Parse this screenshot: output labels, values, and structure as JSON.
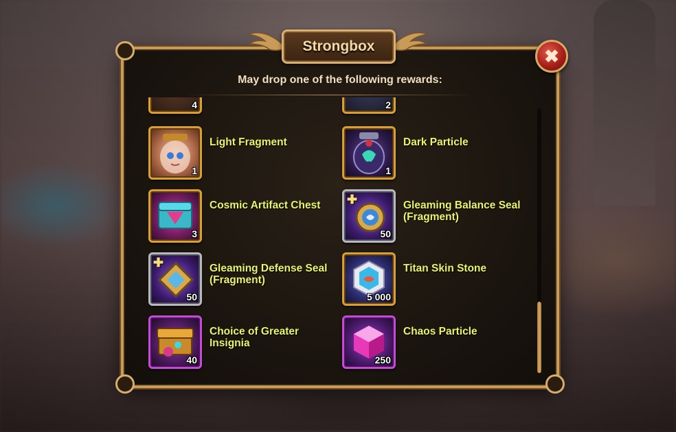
{
  "dialog": {
    "title": "Strongbox",
    "subtitle": "May drop one of the following rewards:",
    "close_glyph": "✖"
  },
  "partial_items": [
    {
      "count": "4"
    },
    {
      "count": "2"
    }
  ],
  "items": [
    {
      "name": "Light Fragment",
      "count": "1",
      "icon": "light-fragment-jar-icon"
    },
    {
      "name": "Dark Particle",
      "count": "1",
      "icon": "dark-particle-jar-icon"
    },
    {
      "name": "Cosmic Artifact Chest",
      "count": "3",
      "icon": "cosmic-artifact-chest-icon"
    },
    {
      "name": "Gleaming Balance Seal (Fragment)",
      "count": "50",
      "icon": "balance-seal-icon"
    },
    {
      "name": "Gleaming Defense Seal (Fragment)",
      "count": "50",
      "icon": "defense-seal-icon"
    },
    {
      "name": "Titan Skin Stone",
      "count": "5 000",
      "icon": "titan-skin-stone-icon"
    },
    {
      "name": "Choice of Greater Insignia",
      "count": "40",
      "icon": "insignia-chest-icon"
    },
    {
      "name": "Chaos Particle",
      "count": "250",
      "icon": "chaos-particle-cube-icon"
    }
  ],
  "scroll": {
    "position": 1.0
  },
  "colors": {
    "name_text": "#e8f56a",
    "frame_gold": "#c99b59",
    "close_red": "#a21d16"
  }
}
